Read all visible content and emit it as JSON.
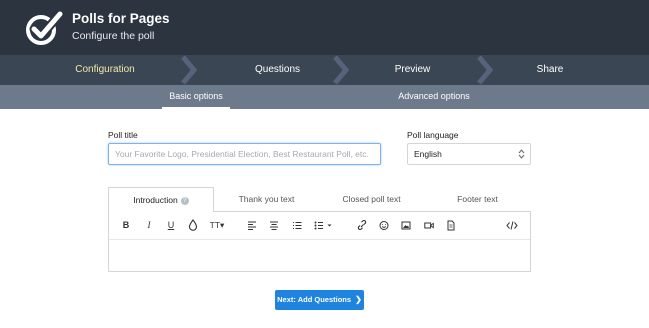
{
  "header": {
    "title": "Polls for Pages",
    "subtitle": "Configure the poll",
    "logo_icon": "checkmark-badge-icon"
  },
  "steps": [
    {
      "label": "Configuration",
      "active": true
    },
    {
      "label": "Questions",
      "active": false
    },
    {
      "label": "Preview",
      "active": false
    },
    {
      "label": "Share",
      "active": false
    }
  ],
  "subtabs": [
    {
      "label": "Basic options",
      "active": true
    },
    {
      "label": "Advanced options",
      "active": false
    }
  ],
  "form": {
    "poll_title_label": "Poll title",
    "poll_title_placeholder": "Your Favorite Logo, Presidential Election, Best Restaurant Poll, etc.",
    "poll_title_value": "",
    "language_label": "Poll language",
    "language_value": "English"
  },
  "text_tabs": [
    {
      "label": "Introduction",
      "active": true,
      "help": "?"
    },
    {
      "label": "Thank you text",
      "active": false
    },
    {
      "label": "Closed poll text",
      "active": false
    },
    {
      "label": "Footer text",
      "active": false
    }
  ],
  "toolbar": {
    "bold": "B",
    "italic": "I",
    "underline": "U",
    "font_size": "TT",
    "icons": [
      "bold-icon",
      "italic-icon",
      "underline-icon",
      "color-drop-icon",
      "font-size-icon",
      "align-left-icon",
      "align-center-icon",
      "ordered-list-icon",
      "unordered-list-icon",
      "link-icon",
      "emoji-icon",
      "image-icon",
      "video-icon",
      "file-icon",
      "code-icon"
    ]
  },
  "next_button_label": "Next: Add Questions",
  "colors": {
    "header_bg": "#2c3440",
    "steps_bg": "#3b4654",
    "subtabs_bg": "#6d7a8b",
    "active_step": "#f4e8a8",
    "primary": "#1f83e0"
  }
}
